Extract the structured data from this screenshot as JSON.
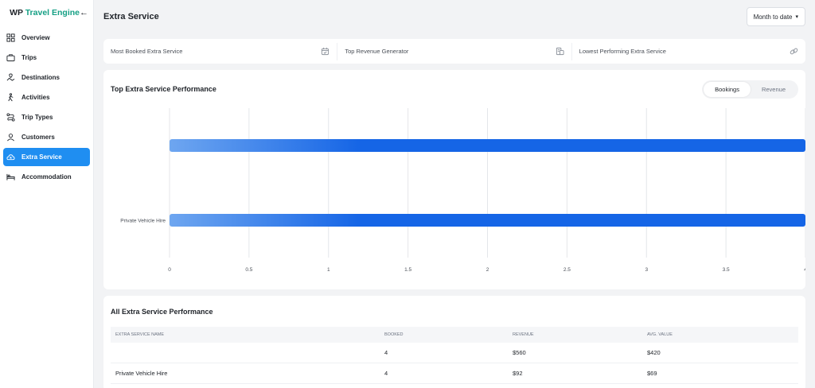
{
  "brand": {
    "wp": "WP",
    "te": "Travel Engine"
  },
  "sidebar": {
    "items": [
      {
        "label": "Overview",
        "icon": "grid-icon"
      },
      {
        "label": "Trips",
        "icon": "suitcase-icon"
      },
      {
        "label": "Destinations",
        "icon": "destination-icon"
      },
      {
        "label": "Activities",
        "icon": "hiker-icon"
      },
      {
        "label": "Trip Types",
        "icon": "route-icon"
      },
      {
        "label": "Customers",
        "icon": "user-icon"
      },
      {
        "label": "Extra Service",
        "icon": "cloud-star-icon",
        "active": true
      },
      {
        "label": "Accommodation",
        "icon": "bed-icon"
      }
    ]
  },
  "header": {
    "title": "Extra Service",
    "range": "Month to date"
  },
  "kpis": [
    {
      "label": "Most Booked Extra Service",
      "icon": "calendar-check-icon"
    },
    {
      "label": "Top Revenue Generator",
      "icon": "coins-icon"
    },
    {
      "label": "Lowest Performing Extra Service",
      "icon": "link-icon"
    }
  ],
  "chart": {
    "title": "Top Extra Service Performance",
    "toggle": [
      "Bookings",
      "Revenue"
    ],
    "active_toggle": "Bookings"
  },
  "chart_data": {
    "type": "bar",
    "orientation": "horizontal",
    "categories": [
      "",
      "Private Vehicle Hire"
    ],
    "values": [
      4,
      4
    ],
    "xlim": [
      0,
      4
    ],
    "xticks": [
      "0",
      "0.5",
      "1",
      "1.5",
      "2",
      "2.5",
      "3",
      "3.5",
      "4"
    ],
    "grid": true,
    "bar_color": "#1565e6"
  },
  "table": {
    "title": "All Extra Service Performance",
    "headers": [
      "Extra Service Name",
      "Booked",
      "Revenue",
      "Avg. Value"
    ],
    "rows": [
      [
        "",
        "4",
        "$560",
        "$420"
      ],
      [
        "Private Vehicle Hire",
        "4",
        "$92",
        "$69"
      ]
    ]
  },
  "colors": {
    "accent": "#1f8ef1",
    "brand_teal": "#16a085"
  }
}
